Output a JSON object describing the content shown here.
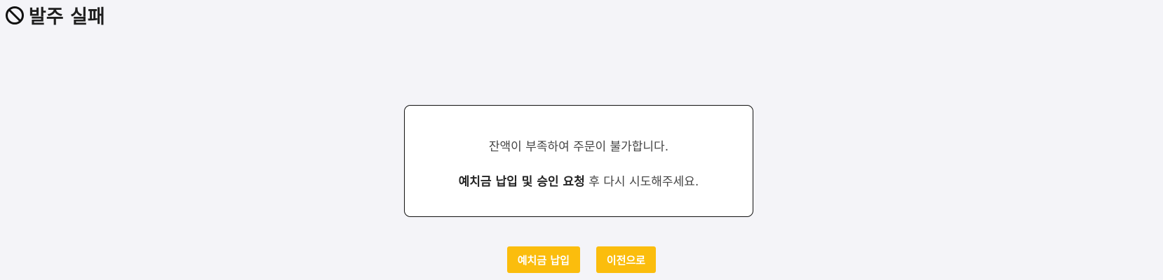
{
  "header": {
    "title": "발주 실패",
    "icon": "prohibited-icon"
  },
  "message": {
    "line1": "잔액이 부족하여 주문이 불가합니다.",
    "line2_emphasis": "예치금 납입 및 승인 요청",
    "line2_rest": " 후 다시 시도해주세요."
  },
  "actions": {
    "deposit_label": "예치금 납입",
    "back_label": "이전으로"
  },
  "colors": {
    "background": "#f4f4f8",
    "button": "#fbbd0d",
    "button_text": "#ffffff"
  }
}
